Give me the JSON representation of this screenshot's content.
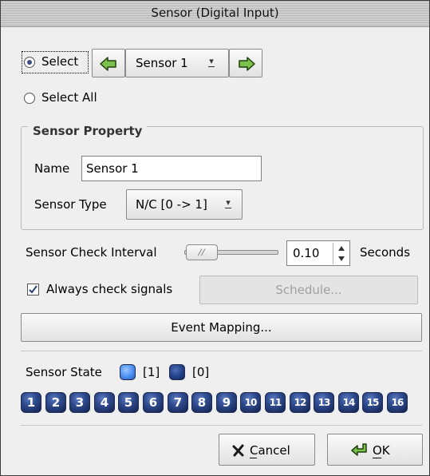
{
  "window": {
    "title": "Sensor (Digital Input)"
  },
  "select": {
    "select_label": "Select",
    "select_all_label": "Select All",
    "selected_mode": "select",
    "sensor_value": "Sensor 1"
  },
  "property": {
    "legend": "Sensor Property",
    "name_label": "Name",
    "name_value": "Sensor 1",
    "type_label": "Sensor Type",
    "type_value": "N/C [0 -> 1]"
  },
  "interval": {
    "label": "Sensor Check Interval",
    "value": "0.10",
    "unit": "Seconds",
    "slider_fraction": 0.02
  },
  "always": {
    "label": "Always check signals",
    "checked": true,
    "schedule_label": "Schedule..."
  },
  "event_mapping_label": "Event Mapping...",
  "state": {
    "label": "Sensor State",
    "on_label": "[1]",
    "off_label": "[0]",
    "on_color": "#4c8ef0",
    "off_color": "#1e3a8a",
    "sensors": [
      "1",
      "2",
      "3",
      "4",
      "5",
      "6",
      "7",
      "8",
      "9",
      "10",
      "11",
      "12",
      "13",
      "14",
      "15",
      "16"
    ]
  },
  "buttons": {
    "cancel_label": "Cancel",
    "ok_label": "OK"
  }
}
